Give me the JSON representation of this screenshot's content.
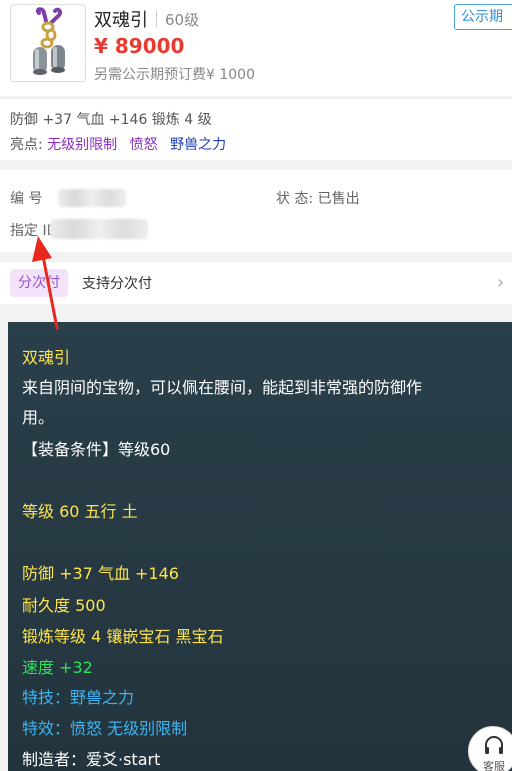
{
  "item": {
    "name": "双魂引",
    "level": "60级",
    "price": "¥ 89000",
    "extra_fee": "另需公示期预订费¥ 1000",
    "period_button": "公示期"
  },
  "stats": {
    "line": "防御 +37 气血 +146 锻炼 4 级",
    "highlights_label": "亮点:",
    "highlights": [
      "无级别限制",
      "愤怒",
      "野兽之力"
    ]
  },
  "info": {
    "serial_label": "编 号",
    "status_label": "状 态:",
    "status_value": "已售出",
    "id_label": "指定 ID"
  },
  "installment": {
    "tag": "分次付",
    "text": "支持分次付"
  },
  "description": {
    "title": "双魂引",
    "desc_line1": "来自阴间的宝物，可以佩在腰间，能起到非常强的防御作",
    "desc_line2": "用。",
    "equip": "【装备条件】等级60",
    "level_line": "等级 60 五行 土",
    "stat_line": "防御 +37 气血 +146",
    "durability": "耐久度 500",
    "forge": "锻炼等级 4 镶嵌宝石 黑宝石",
    "speed": "速度 +32",
    "skill": "特技：野兽之力",
    "effect": "特效：愤怒 无级别限制",
    "maker": "制造者：爱爻·start"
  },
  "service": {
    "label": "客服"
  },
  "colors": {
    "price": "#e83a2e",
    "panel_bg": "#2a3f4a",
    "text_yellow": "#ffe34d",
    "text_green": "#2fe05a",
    "text_blue": "#3fb4f0",
    "accent_blue": "#2f8fe0",
    "tag_purple": "#9b4fcf",
    "arrow_red": "#e8281e"
  },
  "icons": {
    "item_image": "jade-pendant-icon",
    "chevron": "chevron-right-icon",
    "service": "headset-icon",
    "annotation": "red-arrow-icon"
  }
}
